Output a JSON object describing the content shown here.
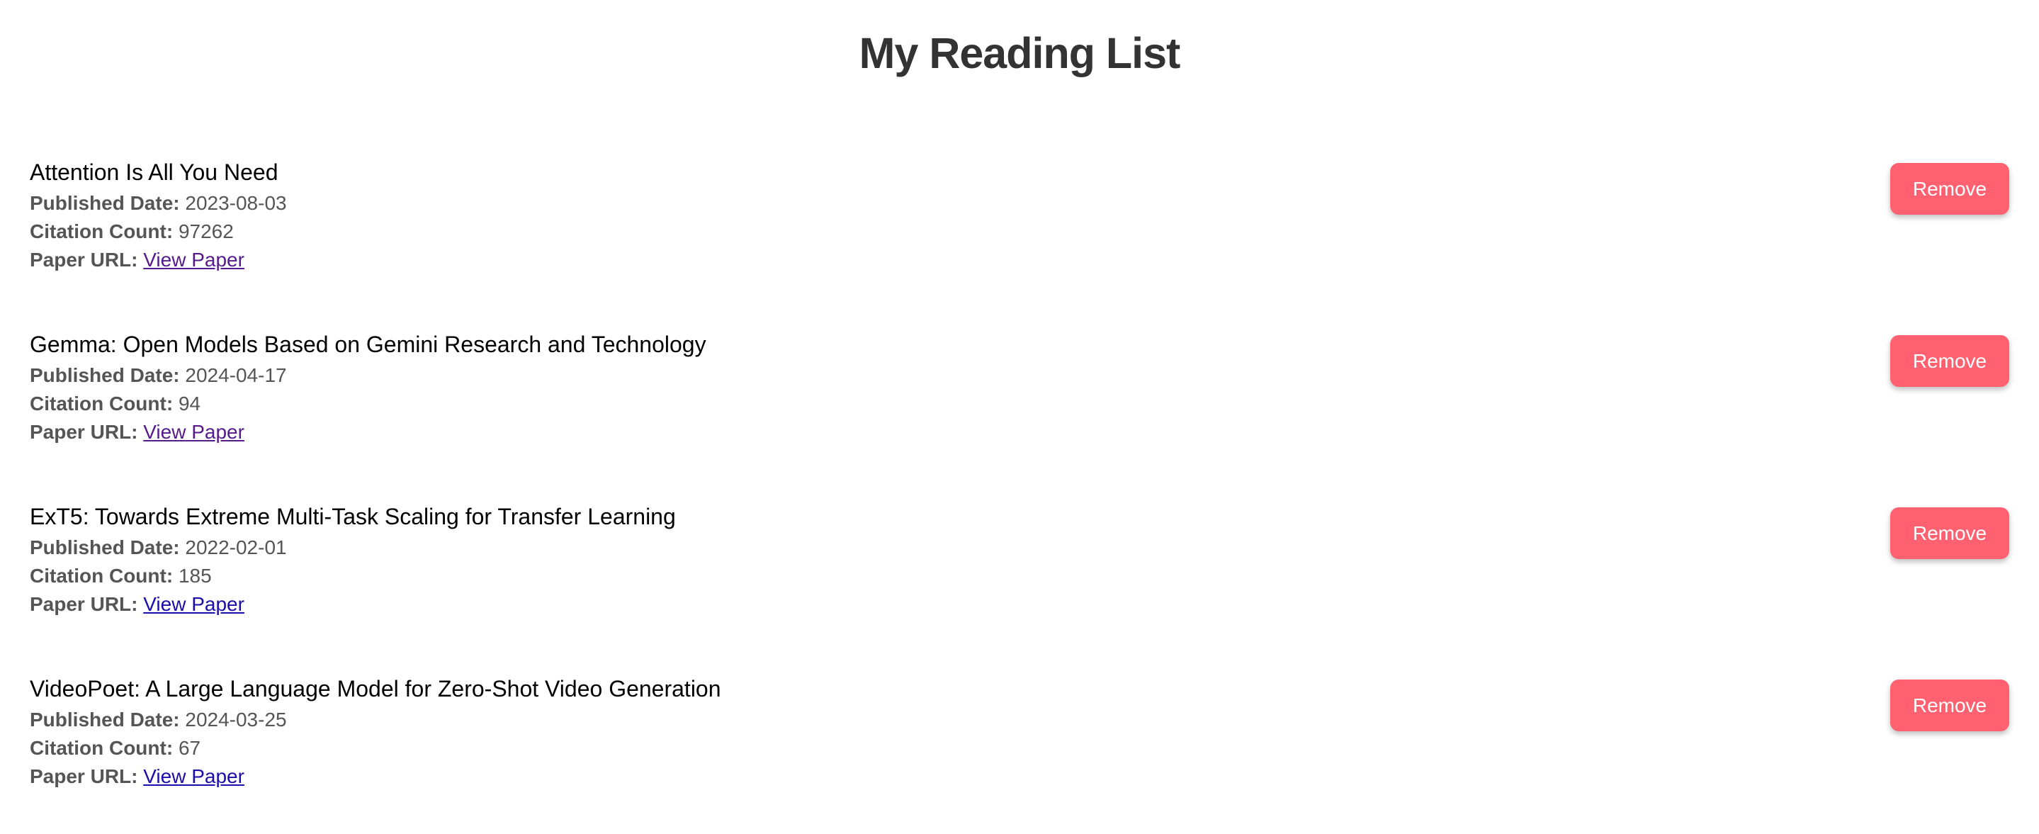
{
  "page": {
    "title": "My Reading List"
  },
  "labels": {
    "published_date": "Published Date:",
    "citation_count": "Citation Count:",
    "paper_url": "Paper URL:",
    "view_paper": "View Paper",
    "remove": "Remove"
  },
  "colors": {
    "remove_button": "#ff6170",
    "link": "#1a0dab",
    "visited_link": "#551a8b",
    "title_text": "#333333",
    "label_text": "#555555"
  },
  "papers": [
    {
      "title": "Attention Is All You Need",
      "published_date": "2023-08-03",
      "citation_count": "97262",
      "link_visited": true
    },
    {
      "title": "Gemma: Open Models Based on Gemini Research and Technology",
      "published_date": "2024-04-17",
      "citation_count": "94",
      "link_visited": true
    },
    {
      "title": "ExT5: Towards Extreme Multi-Task Scaling for Transfer Learning",
      "published_date": "2022-02-01",
      "citation_count": "185",
      "link_visited": false
    },
    {
      "title": "VideoPoet: A Large Language Model for Zero-Shot Video Generation",
      "published_date": "2024-03-25",
      "citation_count": "67",
      "link_visited": false
    }
  ]
}
